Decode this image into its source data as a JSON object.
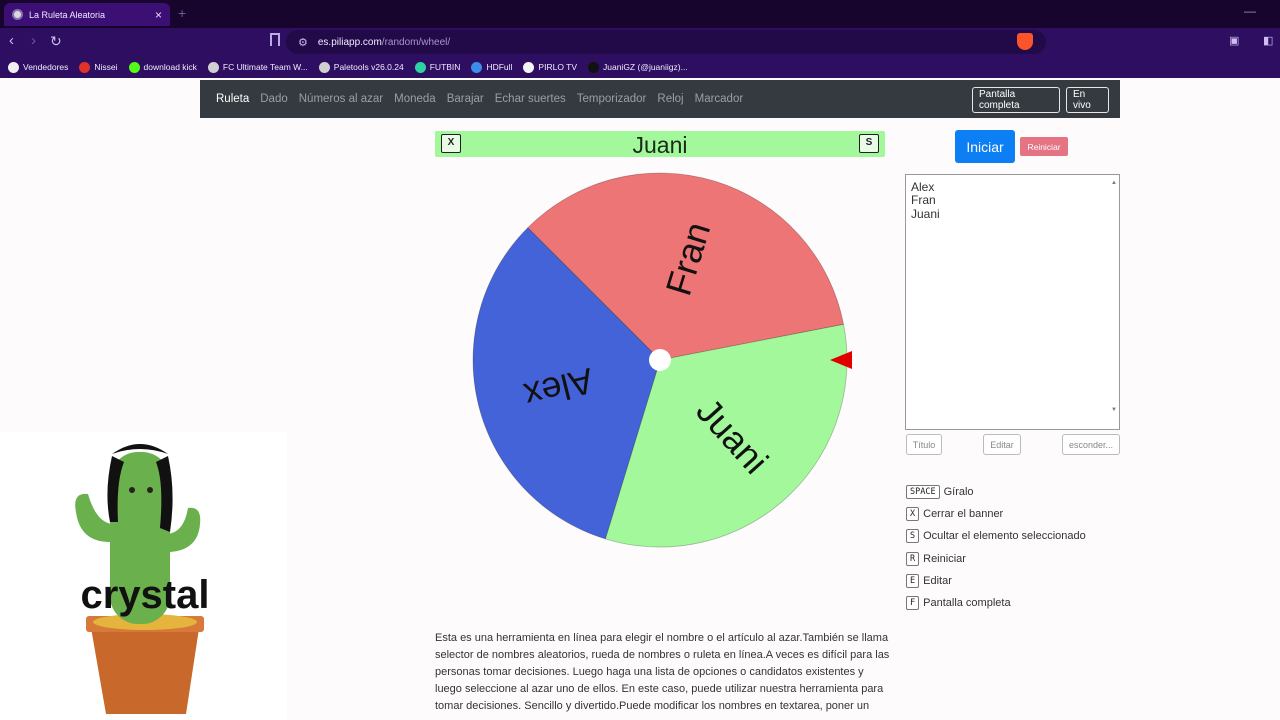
{
  "browser": {
    "tab_title": "La Ruleta Aleatoria",
    "tab_close": "×",
    "new_tab": "+",
    "url_domain": "es.piliapp.com",
    "url_path": "/random/wheel/",
    "bookmarks": [
      {
        "label": "Vendedores",
        "color": "#f0f0f0"
      },
      {
        "label": "Nissei",
        "color": "#e0312b"
      },
      {
        "label": "download kick",
        "color": "#53fc18"
      },
      {
        "label": "FC Ultimate Team W...",
        "color": "#d0d0d0"
      },
      {
        "label": "Paletools v26.0.24",
        "color": "#d0d0d0"
      },
      {
        "label": "FUTBIN",
        "color": "#2fd1a0"
      },
      {
        "label": "HDFull",
        "color": "#3b8eea"
      },
      {
        "label": "PIRLO TV",
        "color": "#f4f4f4"
      },
      {
        "label": "JuaniGZ (@juaniigz)...",
        "color": "#111111"
      }
    ]
  },
  "nav": {
    "items": [
      "Ruleta",
      "Dado",
      "Números al azar",
      "Moneda",
      "Barajar",
      "Echar suertes",
      "Temporizador",
      "Reloj",
      "Marcador"
    ],
    "fullscreen": "Pantalla completa",
    "live": "En vivo"
  },
  "banner": {
    "winner": "Juani",
    "close_key": "X",
    "hide_key": "S",
    "color": "#a2f89a"
  },
  "wheel": {
    "segments": [
      {
        "label": "Fran",
        "color": "#ee7575"
      },
      {
        "label": "Juani",
        "color": "#a2f89a"
      },
      {
        "label": "Alex",
        "color": "#4563d9"
      }
    ],
    "pointer_color": "#e00000"
  },
  "panel": {
    "start": "Iniciar",
    "reset": "Reiniciar",
    "names": [
      "Alex",
      "Fran",
      "Juani"
    ],
    "title_btn": "Título",
    "edit_btn": "Editar",
    "hide_btn": "esconder..."
  },
  "shortcuts": [
    {
      "key": "SPACE",
      "label": "Gíralo"
    },
    {
      "key": "X",
      "label": "Cerrar el banner"
    },
    {
      "key": "S",
      "label": "Ocultar el elemento seleccionado"
    },
    {
      "key": "R",
      "label": "Reiniciar"
    },
    {
      "key": "E",
      "label": "Editar"
    },
    {
      "key": "F",
      "label": "Pantalla completa"
    }
  ],
  "description": "Esta es una herramienta en línea para elegir el nombre o el artículo al azar.También se llama selector de nombres aleatorios, rueda de nombres o ruleta en línea.A veces es difícil para las personas tomar decisiones. Luego haga una lista de opciones o candidatos existentes y luego seleccione al azar uno de ellos. En este caso, puede utilizar nuestra herramienta para tomar decisiones. Sencillo y divertido.Puede modificar los nombres en textarea, poner un",
  "sticker": {
    "text": "crystal"
  }
}
